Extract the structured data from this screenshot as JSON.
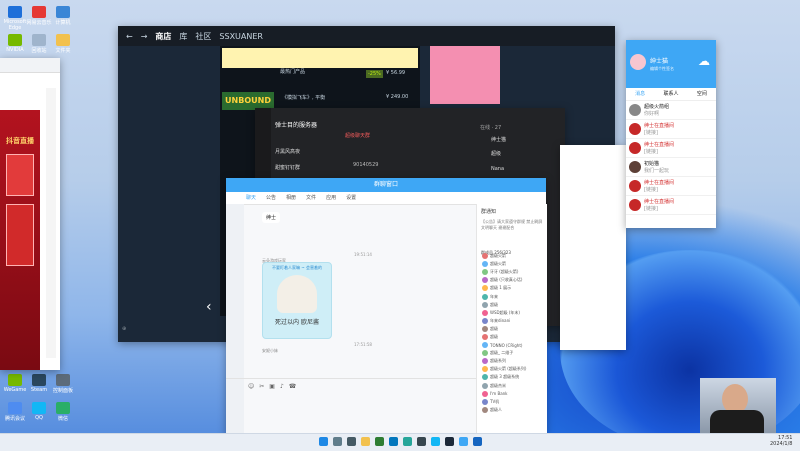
{
  "colors": {
    "qq_blue": "#3ea7f5",
    "steam_dark": "#1b2838",
    "dark_panel": "#222326"
  },
  "steam": {
    "nav": [
      "商店",
      "库",
      "社区"
    ],
    "user": "SSXUANER",
    "price_badge": "-25%",
    "price": "¥ 56.99",
    "price2": "¥ 249.00",
    "banner": "UNBOUND",
    "game_title": "《模拟飞车》, 平衡",
    "section": "最热门产品"
  },
  "qq_dark": {
    "chat_title": "弹士目的服务器",
    "group1": "月黑风高夜",
    "group2": "甜蜜钉钉群",
    "group3": "超级聊天群",
    "number": "90140529",
    "right_header": "在线 · 27",
    "members": [
      "绅士猫",
      "超级",
      "Nana"
    ]
  },
  "qq_chat": {
    "title": "群聊窗口",
    "tabs": [
      "聊天",
      "公告",
      "相册",
      "文件",
      "应用",
      "设置"
    ],
    "msg1": "绅士",
    "time1": "19:51:14",
    "sender2": "云朵游戏玩家",
    "sticker_caption": "死过以内 欧尼酱",
    "sticker_top": "不要盯着人家嘛 ~ 会害羞的",
    "time2": "17:51:58",
    "sender3": "安妮小妹",
    "notice_title": "群通知",
    "notice_text": "【公告】请大家遵守群规 禁止刷屏 文明聊天 谢谢配合",
    "members_header": "群成员 256/323",
    "member_names": [
      "超级火箭",
      "超级火箭",
      "牙牙 (超级火箭)",
      "超级 (只收真心话)",
      "超级 1 展示",
      "年来",
      "超级",
      "WSD超级 (年末)",
      "年来dinani",
      "超级",
      "超级",
      "TONNO (CRight)",
      "超级_ 二维子",
      "超级系列",
      "超级火箭 (超级系列)",
      "超级 3 超级系统",
      "超级杰米",
      "I'm Bank",
      "TV机",
      "超级人"
    ]
  },
  "qq_main": {
    "name": "绅士猫",
    "status": "编辑个性签名",
    "tabs": [
      "消息",
      "联系人",
      "空间"
    ],
    "chats": [
      {
        "name": "超级火箭组",
        "msg": "你好啊"
      },
      {
        "name": "绅士在直播间",
        "msg": "[链接]"
      },
      {
        "name": "绅士在直播间",
        "msg": "[链接]"
      },
      {
        "name": "初始猫",
        "msg": "我们一起玩"
      },
      {
        "name": "绅士在直播间",
        "msg": "[链接]"
      },
      {
        "name": "绅士在直播间",
        "msg": "[链接]"
      }
    ]
  },
  "left_browser": {
    "title": "抖音直播"
  },
  "desktop_icons": [
    "Microsoft Edge",
    "NVIDIA",
    "网易云音乐",
    "计算机",
    "回收站",
    "文件夹",
    "WeGame",
    "Steam",
    "控制面板",
    "腾讯会议",
    "QQ",
    "微信"
  ],
  "taskbar": {
    "time": "17:51",
    "date": "2024/1/8"
  }
}
